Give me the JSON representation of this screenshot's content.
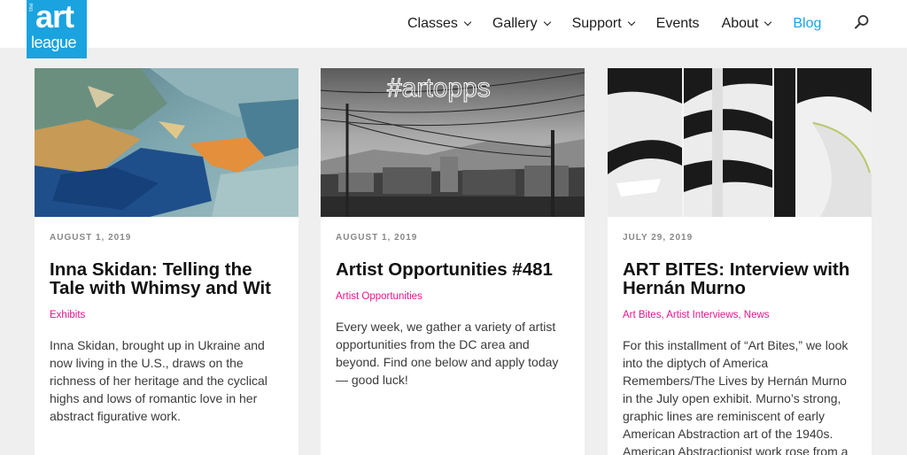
{
  "logo": {
    "small": "the",
    "word1": "art",
    "word2": "league"
  },
  "nav": {
    "items": [
      {
        "label": "Classes",
        "dropdown": true
      },
      {
        "label": "Gallery",
        "dropdown": true
      },
      {
        "label": "Support",
        "dropdown": true
      },
      {
        "label": "Events",
        "dropdown": false
      },
      {
        "label": "About",
        "dropdown": true
      },
      {
        "label": "Blog",
        "dropdown": false,
        "active": true
      }
    ],
    "search_icon": "search-icon"
  },
  "colors": {
    "brand": "#1aa3df",
    "category": "#e4168c",
    "background": "#efefef"
  },
  "posts": [
    {
      "date": "AUGUST 1, 2019",
      "title": "Inna Skidan: Telling the Tale with Whimsy and Wit",
      "categories": "Exhibits",
      "excerpt": "Inna Skidan, brought up in Ukraine and now living in the U.S., draws on the richness of her heritage and the cyclical highs and lows of romantic love in her abstract figurative work."
    },
    {
      "date": "AUGUST 1, 2019",
      "title": "Artist Opportunities #481",
      "categories": "Artist Opportunities",
      "image_text": "#artopps",
      "excerpt": "Every week, we gather a variety of artist opportunities from the DC area and beyond. Find one below and apply today — good luck!"
    },
    {
      "date": "JULY 29, 2019",
      "title": "ART BITES: Interview with Hernán Murno",
      "categories": "Art Bites, Artist Interviews, News",
      "excerpt": "For this installment of “Art Bites,” we look into the diptych of America Remembers/The Lives by Hernán Murno in the July open exhibit. Murno’s strong, graphic lines are reminiscent of early American Abstraction art of the 1940s. American Abstractionist work rose from a"
    }
  ]
}
